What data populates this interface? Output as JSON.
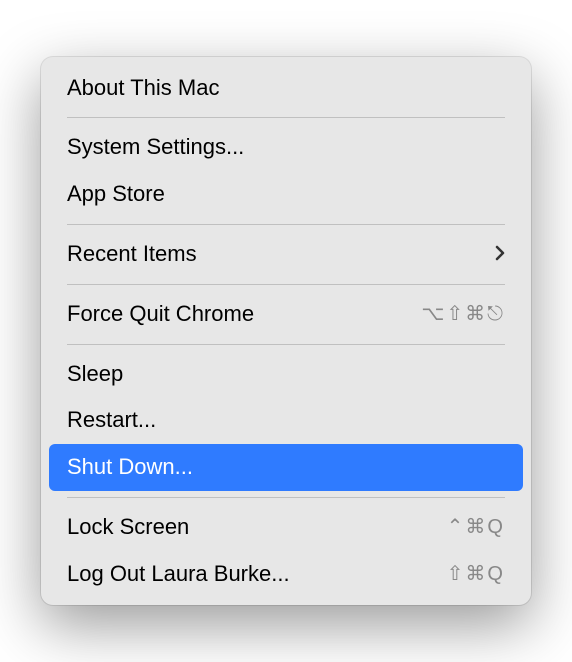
{
  "menu": {
    "groups": [
      [
        {
          "id": "about",
          "label": "About This Mac",
          "shortcut": "",
          "submenu": false,
          "highlighted": false
        }
      ],
      [
        {
          "id": "system-settings",
          "label": "System Settings...",
          "shortcut": "",
          "submenu": false,
          "highlighted": false
        },
        {
          "id": "app-store",
          "label": "App Store",
          "shortcut": "",
          "submenu": false,
          "highlighted": false
        }
      ],
      [
        {
          "id": "recent-items",
          "label": "Recent Items",
          "shortcut": "",
          "submenu": true,
          "highlighted": false
        }
      ],
      [
        {
          "id": "force-quit",
          "label": "Force Quit Chrome",
          "shortcut": "⌥⇧⌘⎋",
          "submenu": false,
          "highlighted": false
        }
      ],
      [
        {
          "id": "sleep",
          "label": "Sleep",
          "shortcut": "",
          "submenu": false,
          "highlighted": false
        },
        {
          "id": "restart",
          "label": "Restart...",
          "shortcut": "",
          "submenu": false,
          "highlighted": false
        },
        {
          "id": "shut-down",
          "label": "Shut Down...",
          "shortcut": "",
          "submenu": false,
          "highlighted": true
        }
      ],
      [
        {
          "id": "lock-screen",
          "label": "Lock Screen",
          "shortcut": "⌃⌘Q",
          "submenu": false,
          "highlighted": false
        },
        {
          "id": "log-out",
          "label": "Log Out Laura Burke...",
          "shortcut": "⇧⌘Q",
          "submenu": false,
          "highlighted": false
        }
      ]
    ]
  }
}
